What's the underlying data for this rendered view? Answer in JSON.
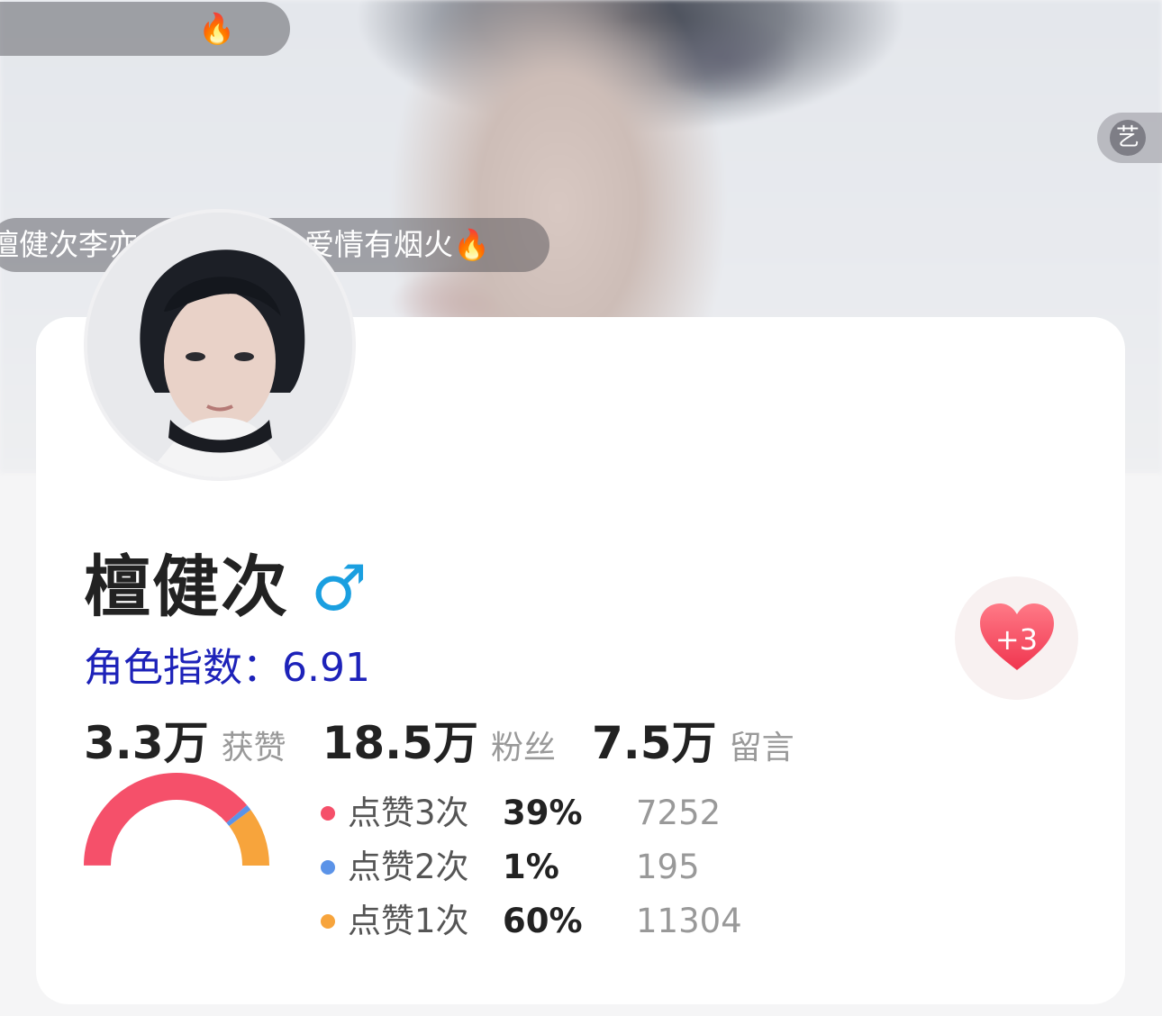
{
  "danmaku": {
    "top_text": "🔥",
    "bottom_left": "檀健次李亦",
    "bottom_right": "爱情有烟火🔥"
  },
  "art_badge": {
    "label": "艺"
  },
  "profile": {
    "name": "檀健次",
    "gender_symbol": "♂",
    "index_label": "角色指数：6.91"
  },
  "stats": [
    {
      "value": "3.3万",
      "label": "获赞"
    },
    {
      "value": "18.5万",
      "label": "粉丝"
    },
    {
      "value": "7.5万",
      "label": "留言"
    }
  ],
  "like_button": {
    "badge": "+3",
    "icon": "heart-icon"
  },
  "chart_data": {
    "type": "pie",
    "donut": true,
    "series": [
      {
        "name": "点赞3次",
        "percent": "39%",
        "count": "7252",
        "value": 7252,
        "color": "#f5506a"
      },
      {
        "name": "点赞2次",
        "percent": "1%",
        "count": "195",
        "value": 195,
        "color": "#5b93e8"
      },
      {
        "name": "点赞1次",
        "percent": "60%",
        "count": "11304",
        "value": 11304,
        "color": "#f7a43c"
      }
    ]
  }
}
